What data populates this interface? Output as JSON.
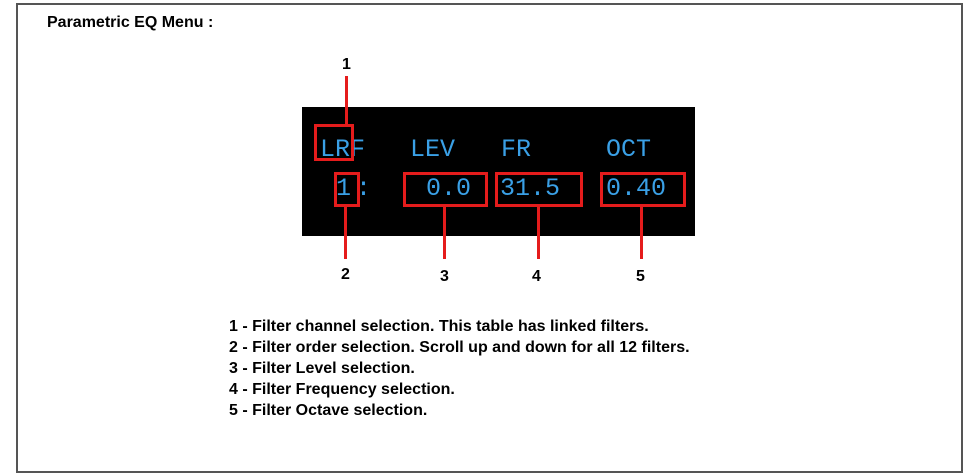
{
  "title": "Parametric EQ Menu :",
  "display": {
    "headers": [
      "LRF",
      "LEV",
      "FR",
      "OCT"
    ],
    "values": {
      "order": "1",
      "separator": ":",
      "level": "0.0",
      "frequency": "31.5",
      "octave": "0.40"
    }
  },
  "callouts": [
    "1",
    "2",
    "3",
    "4",
    "5"
  ],
  "legend": [
    "1 - Filter channel selection. This table has linked filters.",
    "2 - Filter order selection. Scroll up and down for all 12 filters.",
    "3 - Filter Level selection.",
    "4 - Filter Frequency selection.",
    "5 - Filter Octave selection."
  ],
  "colors": {
    "screen_background": "#000000",
    "lcd_text": "#3aa0e6",
    "highlight": "#e51c1c"
  }
}
